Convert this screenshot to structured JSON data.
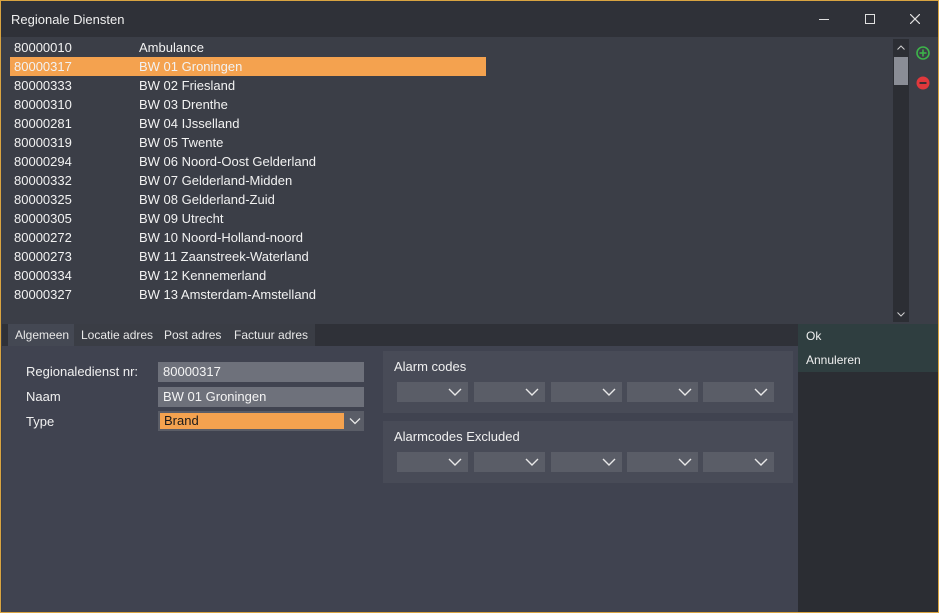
{
  "window": {
    "title": "Regionale Diensten"
  },
  "list": {
    "selected_index": 1,
    "rows": [
      {
        "code": "80000010",
        "name": "Ambulance"
      },
      {
        "code": "80000317",
        "name": "BW 01 Groningen"
      },
      {
        "code": "80000333",
        "name": "BW 02 Friesland"
      },
      {
        "code": "80000310",
        "name": "BW 03 Drenthe"
      },
      {
        "code": "80000281",
        "name": "BW 04 IJsselland"
      },
      {
        "code": "80000319",
        "name": "BW 05 Twente"
      },
      {
        "code": "80000294",
        "name": "BW 06 Noord-Oost Gelderland"
      },
      {
        "code": "80000332",
        "name": "BW 07 Gelderland-Midden"
      },
      {
        "code": "80000325",
        "name": "BW 08 Gelderland-Zuid"
      },
      {
        "code": "80000305",
        "name": "BW 09 Utrecht"
      },
      {
        "code": "80000272",
        "name": "BW 10 Noord-Holland-noord"
      },
      {
        "code": "80000273",
        "name": "BW 11 Zaanstreek-Waterland"
      },
      {
        "code": "80000334",
        "name": "BW 12 Kennemerland"
      },
      {
        "code": "80000327",
        "name": "BW 13 Amsterdam-Amstelland"
      }
    ]
  },
  "tabs": [
    {
      "label": "Algemeen"
    },
    {
      "label": "Locatie adres"
    },
    {
      "label": "Post adres"
    },
    {
      "label": "Factuur adres"
    }
  ],
  "form": {
    "nr_label": "Regionaledienst nr:",
    "nr_value": "80000317",
    "naam_label": "Naam",
    "naam_value": "BW 01 Groningen",
    "type_label": "Type",
    "type_value": "Brand"
  },
  "alarm_codes": {
    "title": "Alarm codes"
  },
  "alarmcodes_excluded": {
    "title": "Alarmcodes Excluded"
  },
  "side_buttons": {
    "ok": "Ok",
    "cancel": "Annuleren"
  },
  "colors": {
    "accent": "#f4a24f",
    "add": "#3db34a",
    "remove": "#e0383c",
    "border": "#d9a441"
  },
  "icons": {
    "minimize": "minimize-icon",
    "maximize": "maximize-icon",
    "close": "close-icon",
    "add": "add-circle-icon",
    "remove": "remove-circle-icon"
  }
}
